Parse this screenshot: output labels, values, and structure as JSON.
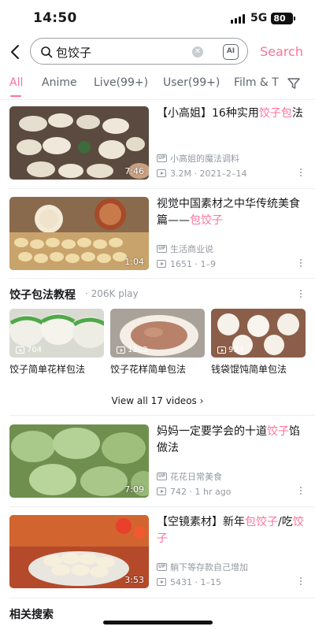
{
  "status_bar": {
    "time": "14:50",
    "network": "5G",
    "battery": "80"
  },
  "search": {
    "query": "包饺子",
    "ai_label": "AI",
    "button_label": "Search"
  },
  "tabs": [
    {
      "label": "All",
      "active": true
    },
    {
      "label": "Anime"
    },
    {
      "label": "Live(99+)"
    },
    {
      "label": "User(99+)"
    },
    {
      "label": "Film & T"
    }
  ],
  "videos": [
    {
      "title_parts": [
        "【小高姐】16种实用",
        "饺子包",
        "法"
      ],
      "uploader": "小高姐的魔法调料",
      "stats": "3.2M · 2021–2–14",
      "duration": "7:46"
    },
    {
      "title_parts": [
        "视觉中国素材之中华传统美食篇——",
        "包饺子",
        ""
      ],
      "uploader": "生活商业说",
      "stats": "1651 · 1–9",
      "duration": "1:04"
    },
    {
      "title_parts": [
        "妈妈一定要学会的十道",
        "饺子",
        "馅做法"
      ],
      "uploader": "花花日常美食",
      "stats": "742 · 1 hr ago",
      "duration": "7:09"
    },
    {
      "title_parts": [
        "【空镜素材】新年",
        "包饺子",
        "/吃",
        "饺子",
        ""
      ],
      "uploader": "躺下等存款自己增加",
      "stats": "5431 · 1–15",
      "duration": "3:53"
    }
  ],
  "collection": {
    "title": "饺子包法教程",
    "plays": "· 206K play",
    "items": [
      {
        "label": "饺子简单花样包法",
        "count": "704"
      },
      {
        "label": "饺子花样简单包法",
        "count": "1303"
      },
      {
        "label": "钱袋馄饨简单包法",
        "count": "933"
      }
    ],
    "view_all": "View all 17 videos"
  },
  "related_title": "相关搜索",
  "up_badge": "UP",
  "colors": {
    "accent": "#fb7299",
    "muted": "#9499a0",
    "text": "#18191c"
  }
}
